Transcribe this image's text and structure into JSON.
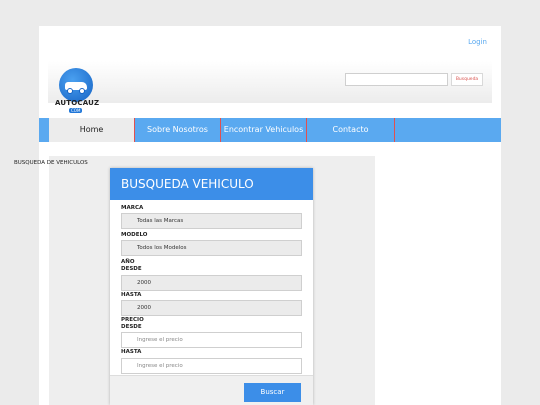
{
  "header": {
    "login_label": "Login",
    "logo": {
      "brand": "AUTOCAUZ",
      "suffix": "COM"
    },
    "search": {
      "input_value": "",
      "button_label": "Busqueda"
    }
  },
  "nav": {
    "items": [
      {
        "label": "Home",
        "active": true
      },
      {
        "label": "Sobre Nosotros",
        "active": false
      },
      {
        "label": "Encontrar Vehiculos",
        "active": false
      },
      {
        "label": "Contacto",
        "active": false
      }
    ]
  },
  "results": {
    "title": "BUSQUEDA DE VEHICULOS"
  },
  "form": {
    "title": "BUSQUEDA VEHICULO",
    "marca": {
      "label": "MARCA",
      "value": "Todas las Marcas"
    },
    "modelo": {
      "label": "MODELO",
      "value": "Todos los Modelos"
    },
    "anio": {
      "label": "AÑO",
      "desde_label": "DESDE",
      "desde_value": "2000",
      "hasta_label": "HASTA",
      "hasta_value": "2000"
    },
    "precio": {
      "label": "PRECIO",
      "desde_label": "DESDE",
      "desde_placeholder": "Ingrese el precio",
      "hasta_label": "HASTA",
      "hasta_placeholder": "Ingrese el precio"
    },
    "submit_label": "Buscar"
  },
  "colors": {
    "accent": "#3c8ee8",
    "nav": "#5aa9f0",
    "nav_divider": "#e05050",
    "search_button_text": "#d9534f"
  }
}
